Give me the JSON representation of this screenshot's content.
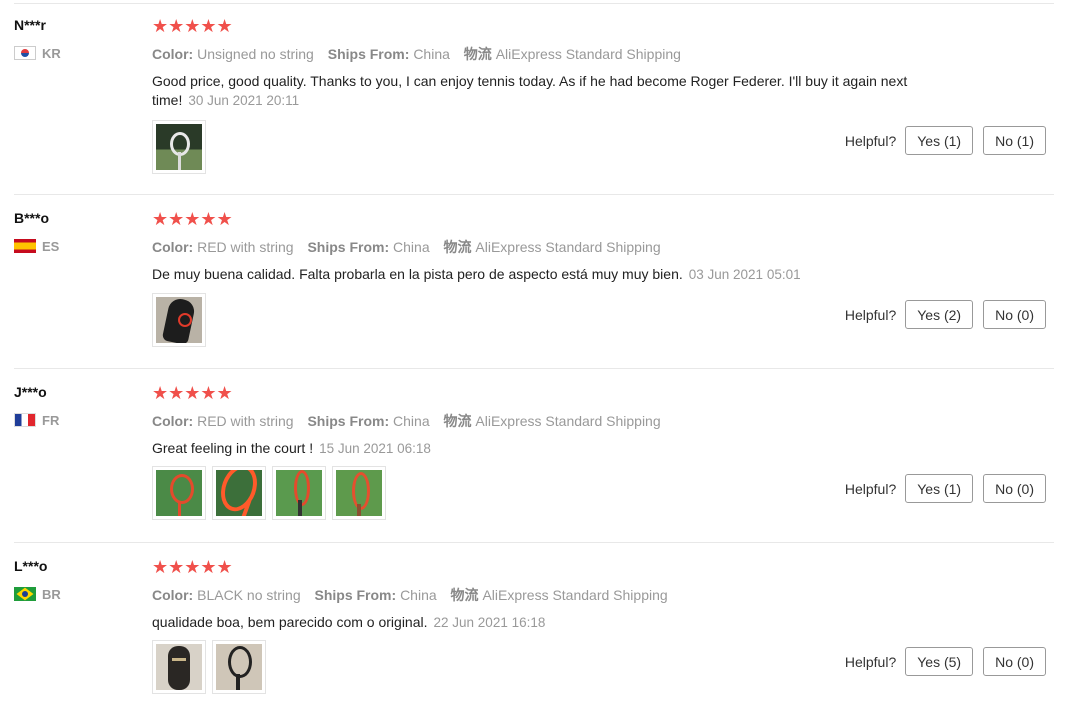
{
  "reviews": [
    {
      "user": "N***r",
      "country": "KR",
      "stars": "★★★★★",
      "color_label": "Color:",
      "color": "Unsigned no string",
      "ships_label": "Ships From:",
      "ships_from": "China",
      "shipping_label": "物流",
      "shipping": "AliExpress Standard Shipping",
      "comment": "Good price, good quality. Thanks to you, I can enjoy tennis today. As if he had become Roger Federer. I'll buy it again next time!",
      "date": "30 Jun 2021 20:11",
      "helpful_label": "Helpful?",
      "yes": "Yes (1)",
      "no": "No (1)"
    },
    {
      "user": "B***o",
      "country": "ES",
      "stars": "★★★★★",
      "color_label": "Color:",
      "color": "RED with string",
      "ships_label": "Ships From:",
      "ships_from": "China",
      "shipping_label": "物流",
      "shipping": "AliExpress Standard Shipping",
      "comment": "De muy buena calidad. Falta probarla en la pista pero de aspecto está muy muy bien.",
      "date": "03 Jun 2021 05:01",
      "helpful_label": "Helpful?",
      "yes": "Yes (2)",
      "no": "No (0)"
    },
    {
      "user": "J***o",
      "country": "FR",
      "stars": "★★★★★",
      "color_label": "Color:",
      "color": "RED with string",
      "ships_label": "Ships From:",
      "ships_from": "China",
      "shipping_label": "物流",
      "shipping": "AliExpress Standard Shipping",
      "comment": "Great feeling in the court !",
      "date": "15 Jun 2021 06:18",
      "helpful_label": "Helpful?",
      "yes": "Yes (1)",
      "no": "No (0)"
    },
    {
      "user": "L***o",
      "country": "BR",
      "stars": "★★★★★",
      "color_label": "Color:",
      "color": "BLACK no string",
      "ships_label": "Ships From:",
      "ships_from": "China",
      "shipping_label": "物流",
      "shipping": "AliExpress Standard Shipping",
      "comment": "qualidade boa, bem parecido com o original.",
      "date": "22 Jun 2021 16:18",
      "helpful_label": "Helpful?",
      "yes": "Yes (5)",
      "no": "No (0)"
    }
  ],
  "colors": {
    "star": "#f0504b",
    "muted_text": "#999999",
    "separator": "#e8e8e8"
  }
}
